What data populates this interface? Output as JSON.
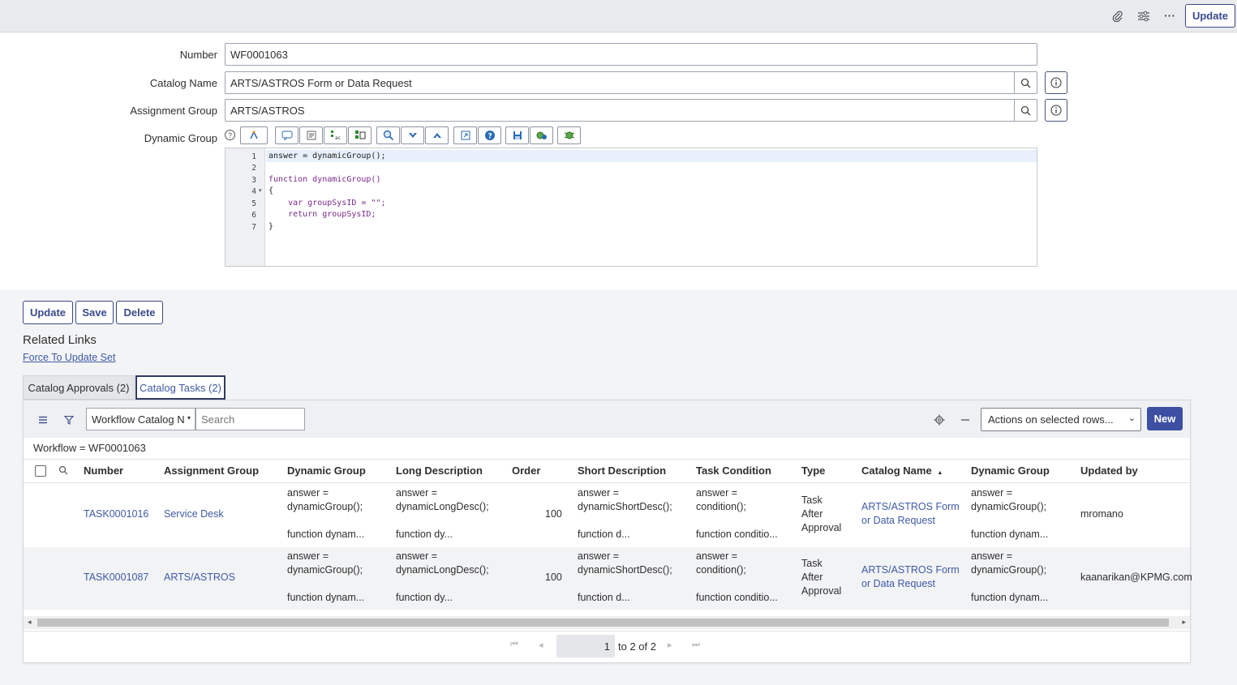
{
  "header": {
    "update_label": "Update",
    "icons": [
      "paperclip-icon",
      "sliders-icon",
      "more-icon"
    ]
  },
  "form": {
    "number": {
      "label": "Number",
      "value": "WF0001063"
    },
    "catalog_name": {
      "label": "Catalog Name",
      "value": "ARTS/ASTROS Form or Data Request"
    },
    "assignment_group": {
      "label": "Assignment Group",
      "value": "ARTS/ASTROS"
    },
    "dynamic_group": {
      "label": "Dynamic Group",
      "help": "?",
      "line_numbers": [
        "1",
        "2",
        "3",
        "4",
        "5",
        "6",
        "7"
      ],
      "code": [
        "answer = dynamicGroup();",
        "",
        "function dynamicGroup()",
        "{",
        "    var groupSysID = \"\";",
        "    return groupSysID;",
        "}"
      ]
    }
  },
  "actions": {
    "update": "Update",
    "save": "Save",
    "delete": "Delete"
  },
  "related_links": {
    "title": "Related Links",
    "force_update": "Force To Update Set"
  },
  "tabs": [
    {
      "label": "Catalog Approvals (2)"
    },
    {
      "label": "Catalog Tasks (2)"
    }
  ],
  "list": {
    "column_select": "Workflow Catalog N",
    "search_placeholder": "Search",
    "actions_select": "Actions on selected rows...",
    "new_label": "New",
    "breadcrumb": "Workflow = WF0001063",
    "columns": [
      "Number",
      "Assignment Group",
      "Dynamic Group",
      "Long Description",
      "Order",
      "Short Description",
      "Task Condition",
      "Type",
      "Catalog Name",
      "Dynamic Group",
      "Updated by"
    ],
    "rows": [
      {
        "number": "TASK0001016",
        "assignment_group": "Service Desk",
        "dynamic_group": [
          "answer =",
          "dynamicGroup();",
          "function dynam..."
        ],
        "long_description": [
          "answer =",
          "dynamicLongDesc();",
          "function dy..."
        ],
        "order": "100",
        "short_description": [
          "answer =",
          "dynamicShortDesc();",
          "function d..."
        ],
        "task_condition": [
          "answer =",
          "condition();",
          "function conditio..."
        ],
        "type": [
          "Task",
          "After",
          "Approval"
        ],
        "catalog_name": [
          "ARTS/ASTROS Form",
          "or Data Request"
        ],
        "dynamic_group2": [
          "answer =",
          "dynamicGroup();",
          "function dynam..."
        ],
        "updated_by": "mromano"
      },
      {
        "number": "TASK0001087",
        "assignment_group": "ARTS/ASTROS",
        "dynamic_group": [
          "answer =",
          "dynamicGroup();",
          "function dynam..."
        ],
        "long_description": [
          "answer =",
          "dynamicLongDesc();",
          "function dy..."
        ],
        "order": "100",
        "short_description": [
          "answer =",
          "dynamicShortDesc();",
          "function d..."
        ],
        "task_condition": [
          "answer =",
          "condition();",
          "function conditio..."
        ],
        "type": [
          "Task",
          "After",
          "Approval"
        ],
        "catalog_name": [
          "ARTS/ASTROS Form",
          "or Data Request"
        ],
        "dynamic_group2": [
          "answer =",
          "dynamicGroup();",
          "function dynam..."
        ],
        "updated_by": "kaanarikan@KPMG.com"
      }
    ],
    "pagination": {
      "page": "1",
      "range": "to 2 of 2"
    }
  },
  "colors": {
    "accent": "#3b4a8a",
    "link": "#3f5aa6",
    "new_button": "#3d4fa3"
  }
}
